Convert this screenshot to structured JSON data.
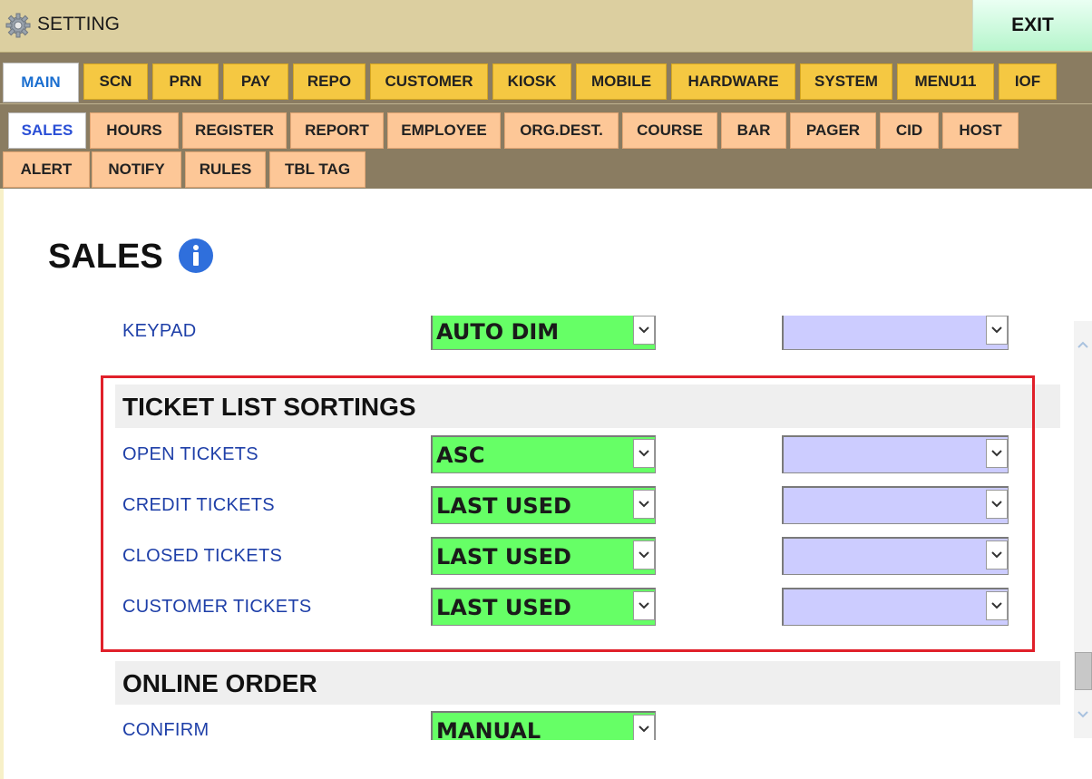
{
  "window": {
    "title": "SETTING",
    "exit_label": "EXIT",
    "title_icon": "gear-icon"
  },
  "main_tabs": [
    {
      "label": "MAIN",
      "active": true
    },
    {
      "label": "SCN"
    },
    {
      "label": "PRN"
    },
    {
      "label": "PAY"
    },
    {
      "label": "REPO"
    },
    {
      "label": "CUSTOMER"
    },
    {
      "label": "KIOSK"
    },
    {
      "label": "MOBILE"
    },
    {
      "label": "HARDWARE"
    },
    {
      "label": "SYSTEM"
    },
    {
      "label": "MENU11"
    },
    {
      "label": "IOF"
    }
  ],
  "sub_tabs_row1": [
    {
      "label": "SALES",
      "active": true
    },
    {
      "label": "HOURS"
    },
    {
      "label": "REGISTER"
    },
    {
      "label": "REPORT"
    },
    {
      "label": "EMPLOYEE"
    },
    {
      "label": "ORG.DEST."
    },
    {
      "label": "COURSE"
    },
    {
      "label": "BAR"
    },
    {
      "label": "PAGER"
    },
    {
      "label": "CID"
    },
    {
      "label": "HOST"
    }
  ],
  "sub_tabs_row2": [
    {
      "label": "ALERT"
    },
    {
      "label": "NOTIFY"
    },
    {
      "label": "RULES"
    },
    {
      "label": "TBL TAG"
    }
  ],
  "page": {
    "title": "SALES",
    "info_icon": "info-icon"
  },
  "keypad": {
    "label": "KEYPAD",
    "value": "AUTO DIM",
    "secondary": ""
  },
  "ticket_sortings": {
    "header": "TICKET LIST SORTINGS",
    "rows": [
      {
        "label": "OPEN TICKETS",
        "value": "ASC",
        "secondary": ""
      },
      {
        "label": "CREDIT TICKETS",
        "value": "LAST USED",
        "secondary": ""
      },
      {
        "label": "CLOSED TICKETS",
        "value": "LAST USED",
        "secondary": ""
      },
      {
        "label": "CUSTOMER TICKETS",
        "value": "LAST USED",
        "secondary": ""
      }
    ]
  },
  "online_order": {
    "header": "ONLINE ORDER",
    "confirm": {
      "label": "CONFIRM",
      "value": "MANUAL"
    }
  },
  "colors": {
    "title_bar": "#dccfa0",
    "tab_bar": "#8a7c61",
    "main_tab": "#f5c842",
    "sub_tab": "#fdc797",
    "select_primary": "#66ff66",
    "select_secondary": "#ccccff",
    "highlight": "#e0202a"
  }
}
